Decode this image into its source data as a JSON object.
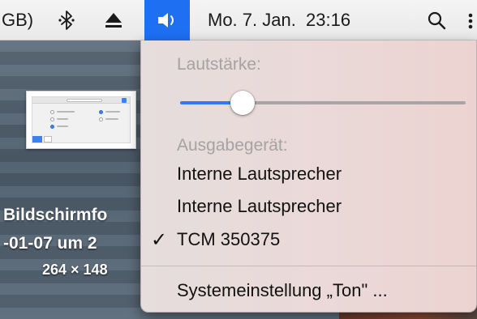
{
  "menubar": {
    "partial_item": "GB)",
    "bluetooth_icon": "bluetooth-icon",
    "eject_icon": "eject-icon",
    "volume_icon": "volume-icon",
    "clock": "Mo. 7. Jan.  23:16",
    "search_icon": "search-icon",
    "more_icon": "more-icon",
    "active_color": "#1e6ff2"
  },
  "volume_menu": {
    "volume_heading": "Lautstärke:",
    "volume_level": 0.22,
    "output_heading": "Ausgabegerät:",
    "devices": [
      {
        "label": "Interne Lautsprecher",
        "checked": false
      },
      {
        "label": "Interne Lautsprecher",
        "checked": false
      },
      {
        "label": "TCM 350375",
        "checked": true
      }
    ],
    "checkmark": "✓",
    "settings_label": "Systemeinstellung „Ton\" ..."
  },
  "desktop": {
    "file_name": "Bildschirmfo",
    "file_date": "-01-07 um 2",
    "file_dimensions": "264 × 148"
  }
}
